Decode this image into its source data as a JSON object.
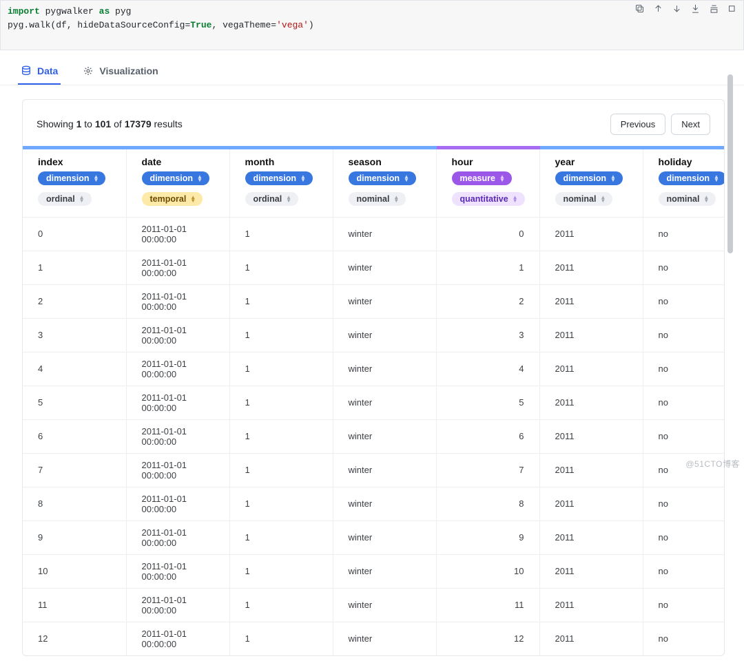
{
  "code": {
    "l1_import": "import",
    "l1_mod": " pygwalker ",
    "l1_as": "as",
    "l1_alias": " pyg",
    "l2_pre": "pyg.walk(df, hideDataSourceConfig=",
    "l2_true": "True",
    "l2_mid": ", vegaTheme=",
    "l2_str": "'vega'",
    "l2_post": ")"
  },
  "tabs": {
    "data": "Data",
    "viz": "Visualization"
  },
  "results": {
    "prefix": "Showing ",
    "from": "1",
    "mid1": " to ",
    "to": "101",
    "mid2": " of ",
    "total": "17379",
    "suffix": " results",
    "prev": "Previous",
    "next": "Next"
  },
  "columns": [
    {
      "name": "index",
      "role": "dimension",
      "role_class": "pill-blue",
      "type": "ordinal",
      "type_class": "pill-gray"
    },
    {
      "name": "date",
      "role": "dimension",
      "role_class": "pill-blue",
      "type": "temporal",
      "type_class": "pill-yellow"
    },
    {
      "name": "month",
      "role": "dimension",
      "role_class": "pill-blue",
      "type": "ordinal",
      "type_class": "pill-gray"
    },
    {
      "name": "season",
      "role": "dimension",
      "role_class": "pill-blue",
      "type": "nominal",
      "type_class": "pill-gray"
    },
    {
      "name": "hour",
      "role": "measure",
      "role_class": "pill-purple",
      "type": "quantitative",
      "type_class": "pill-lpurple"
    },
    {
      "name": "year",
      "role": "dimension",
      "role_class": "pill-blue",
      "type": "nominal",
      "type_class": "pill-gray"
    },
    {
      "name": "holiday",
      "role": "dimension",
      "role_class": "pill-blue",
      "type": "nominal",
      "type_class": "pill-gray"
    }
  ],
  "rows": [
    {
      "index": "0",
      "date": "2011-01-01 00:00:00",
      "month": "1",
      "season": "winter",
      "hour": "0",
      "year": "2011",
      "holiday": "no"
    },
    {
      "index": "1",
      "date": "2011-01-01 00:00:00",
      "month": "1",
      "season": "winter",
      "hour": "1",
      "year": "2011",
      "holiday": "no"
    },
    {
      "index": "2",
      "date": "2011-01-01 00:00:00",
      "month": "1",
      "season": "winter",
      "hour": "2",
      "year": "2011",
      "holiday": "no"
    },
    {
      "index": "3",
      "date": "2011-01-01 00:00:00",
      "month": "1",
      "season": "winter",
      "hour": "3",
      "year": "2011",
      "holiday": "no"
    },
    {
      "index": "4",
      "date": "2011-01-01 00:00:00",
      "month": "1",
      "season": "winter",
      "hour": "4",
      "year": "2011",
      "holiday": "no"
    },
    {
      "index": "5",
      "date": "2011-01-01 00:00:00",
      "month": "1",
      "season": "winter",
      "hour": "5",
      "year": "2011",
      "holiday": "no"
    },
    {
      "index": "6",
      "date": "2011-01-01 00:00:00",
      "month": "1",
      "season": "winter",
      "hour": "6",
      "year": "2011",
      "holiday": "no"
    },
    {
      "index": "7",
      "date": "2011-01-01 00:00:00",
      "month": "1",
      "season": "winter",
      "hour": "7",
      "year": "2011",
      "holiday": "no"
    },
    {
      "index": "8",
      "date": "2011-01-01 00:00:00",
      "month": "1",
      "season": "winter",
      "hour": "8",
      "year": "2011",
      "holiday": "no"
    },
    {
      "index": "9",
      "date": "2011-01-01 00:00:00",
      "month": "1",
      "season": "winter",
      "hour": "9",
      "year": "2011",
      "holiday": "no"
    },
    {
      "index": "10",
      "date": "2011-01-01 00:00:00",
      "month": "1",
      "season": "winter",
      "hour": "10",
      "year": "2011",
      "holiday": "no"
    },
    {
      "index": "11",
      "date": "2011-01-01 00:00:00",
      "month": "1",
      "season": "winter",
      "hour": "11",
      "year": "2011",
      "holiday": "no"
    },
    {
      "index": "12",
      "date": "2011-01-01 00:00:00",
      "month": "1",
      "season": "winter",
      "hour": "12",
      "year": "2011",
      "holiday": "no"
    }
  ],
  "watermark": "@51CTO博客"
}
